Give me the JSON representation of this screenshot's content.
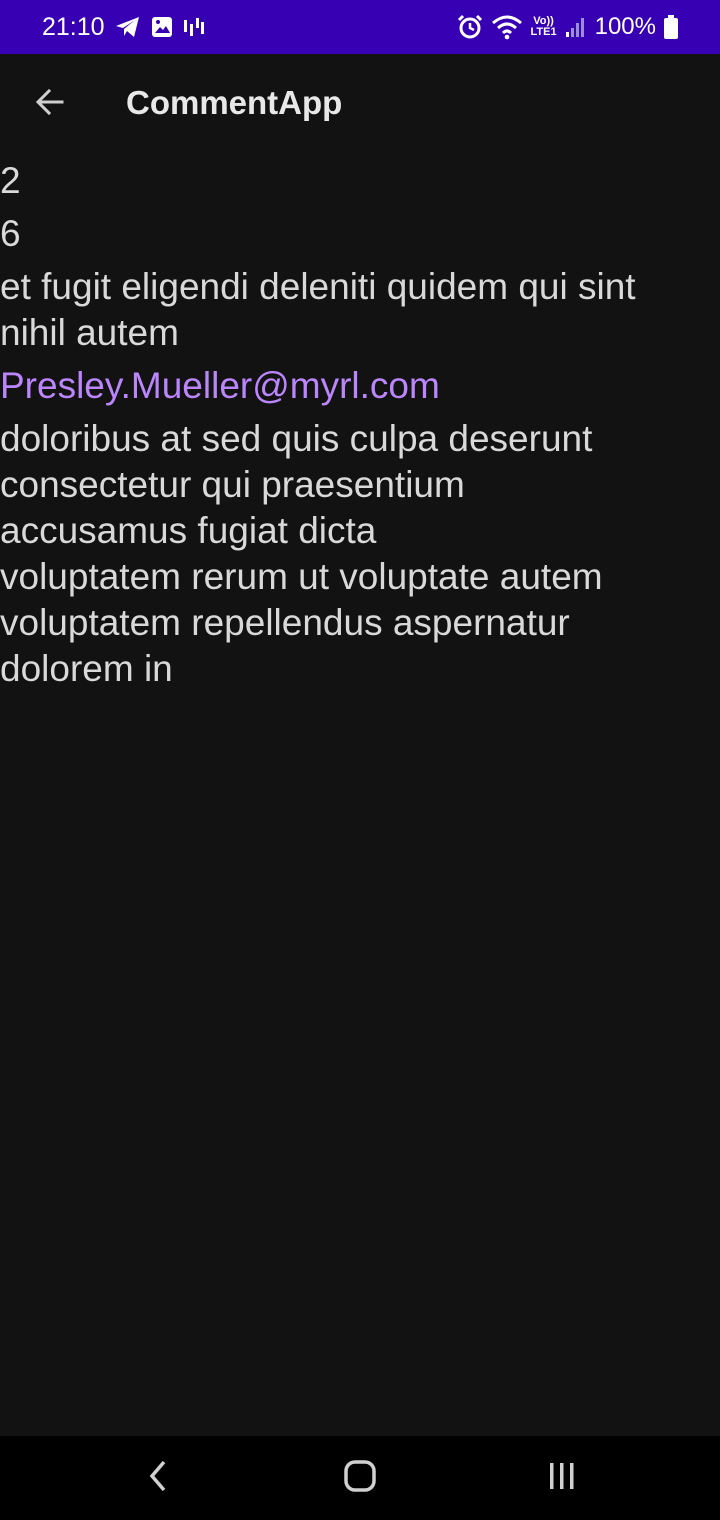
{
  "status_bar": {
    "time": "21:10",
    "battery_text": "100%",
    "left_icons": [
      "telegram-icon",
      "gallery-icon",
      "signal-activity-icon"
    ],
    "right_icons": [
      "alarm-icon",
      "wifi-icon",
      "volte-lte-icon",
      "cell-signal-icon",
      "battery-icon"
    ],
    "network_label_top": "Vo))",
    "network_label_bottom": "LTE1"
  },
  "app_bar": {
    "title": "CommentApp",
    "back_icon": "arrow-back-icon"
  },
  "comment": {
    "post_id": "2",
    "id": "6",
    "name": "et fugit eligendi deleniti quidem qui sint\nnihil autem",
    "email": "Presley.Mueller@myrl.com",
    "body": "doloribus at sed quis culpa deserunt\nconsectetur qui praesentium\naccusamus fugiat dicta\nvoluptatem rerum ut voluptate autem\nvoluptatem repellendus aspernatur\ndolorem in"
  },
  "colors": {
    "status_bar": "#3700b3",
    "background": "#121212",
    "text": "#d9d9d9",
    "email_accent": "#bb86fc",
    "nav_bar": "#000000"
  },
  "nav_bar": {
    "buttons": [
      "back-nav-icon",
      "home-nav-icon",
      "recents-nav-icon"
    ]
  }
}
